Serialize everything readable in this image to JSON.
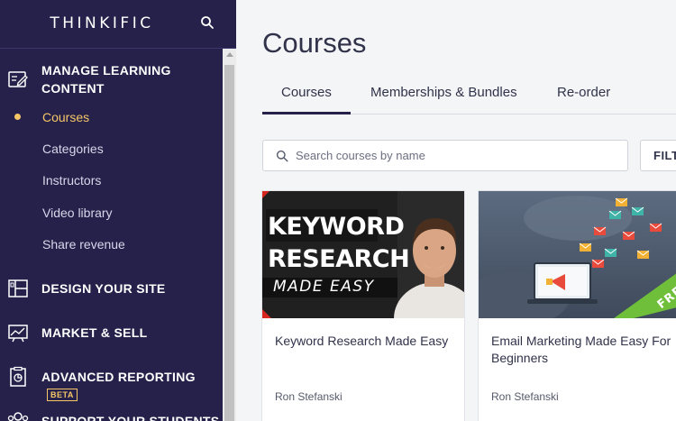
{
  "sidebar": {
    "logo": "THINKIFIC",
    "sections": [
      {
        "title_line1": "MANAGE LEARNING",
        "title_line2": "CONTENT",
        "icon": "edit-icon"
      },
      {
        "title": "DESIGN YOUR SITE",
        "icon": "layout-icon"
      },
      {
        "title": "MARKET & SELL",
        "icon": "chart-icon"
      },
      {
        "title": "ADVANCED REPORTING",
        "icon": "report-icon",
        "badge": "BETA"
      },
      {
        "title": "SUPPORT YOUR STUDENTS",
        "icon": "users-icon"
      }
    ],
    "sub_items": [
      "Courses",
      "Categories",
      "Instructors",
      "Video library",
      "Share revenue"
    ]
  },
  "main": {
    "title": "Courses",
    "tabs": [
      "Courses",
      "Memberships & Bundles",
      "Re-order"
    ],
    "search_placeholder": "Search courses by name",
    "filter_label": "FILT"
  },
  "cards": [
    {
      "title": "Keyword Research Made Easy",
      "author": "Ron Stefanski",
      "thumb_text": [
        "KEYWORD",
        "RESEARCH",
        "MADE EASY"
      ]
    },
    {
      "title": "Email Marketing Made Easy For Beginners",
      "author": "Ron Stefanski",
      "ribbon": "FREE"
    }
  ],
  "colors": {
    "sidebar_bg": "#25214a",
    "accent": "#f6c667",
    "free_ribbon": "#6fbf3a"
  }
}
